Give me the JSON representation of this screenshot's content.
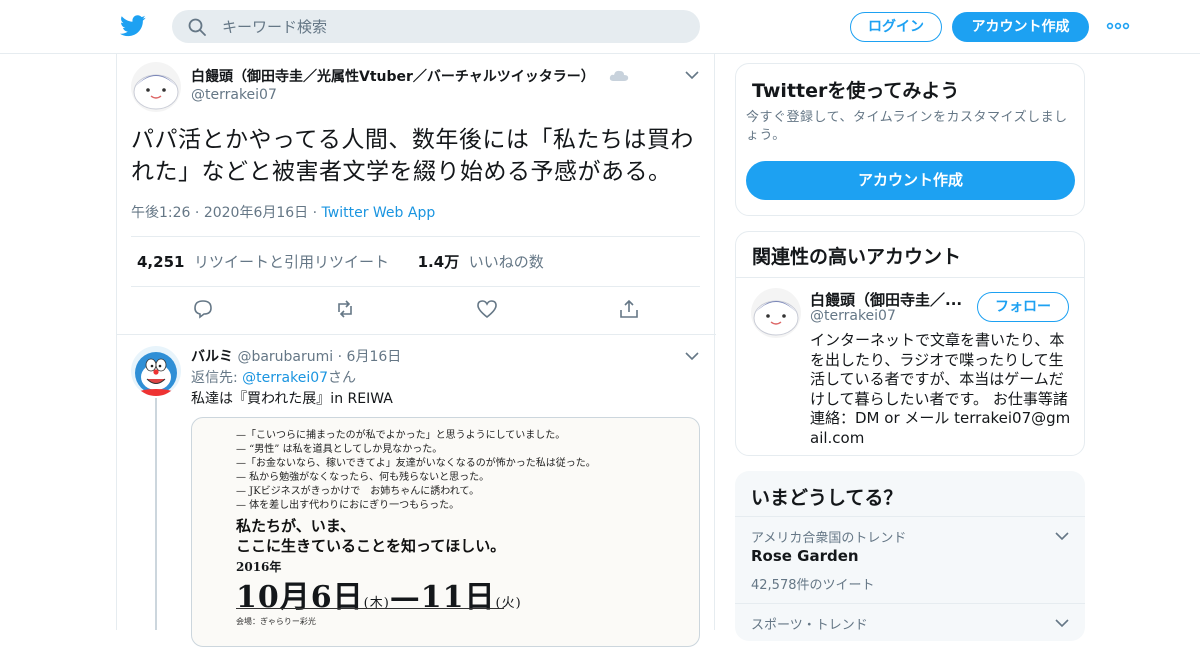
{
  "header": {
    "search_placeholder": "キーワード検索",
    "login_label": "ログイン",
    "signup_label": "アカウント作成",
    "brand_color": "#1da1f2"
  },
  "tweet": {
    "name": "白饅頭（御田寺圭／光属性Vtuber／バーチャルツイッタラー）",
    "handle": "@terrakei07",
    "text": "パパ活とかやってる人間、数年後には「私たちは買われた」などと被害者文学を綴り始める予感がある。",
    "time": "午後1:26",
    "date": "2020年6月16日",
    "source": "Twitter Web App",
    "retweets_count": "4,251",
    "retweets_label": "リツイートと引用リツイート",
    "likes_count": "1.4万",
    "likes_label": "いいねの数"
  },
  "reply": {
    "name": "バルミ",
    "handle": "@barubarumi",
    "date": "6月16日",
    "reply_to_label": "返信先:",
    "reply_to_handle": "@terrakei07",
    "reply_to_suffix": "さん",
    "text": "私達は『買われた展』in REIWA",
    "poster": {
      "lines": [
        "—「こいつらに捕まったのが私でよかった」と思うようにしていました。",
        "— “男性” は私を道具としてしか見なかった。",
        "—「お金ないなら、稼いできてよ」友達がいなくなるのが怖かった私は従った。",
        "— 私から勉強がなくなったら、何も残らないと思った。",
        "— JKビジネスがきっかけで　お姉ちゃんに誘われて。",
        "— 体を差し出す代わりにおにぎり一つもらった。"
      ],
      "headline1": "私たちが、いま、",
      "headline2": "ここに生きていることを知ってほしい。",
      "year": "2016年",
      "date_main": "10月6日",
      "date_start_day": "(木)",
      "date_dash": "—",
      "date_end": "11日",
      "date_end_day": "(火)",
      "venue": "会場：ぎゃらりー彩光"
    }
  },
  "signup_card": {
    "title": "Twitterを使ってみよう",
    "description": "今すぐ登録して、タイムラインをカスタマイズしましょう。",
    "button_label": "アカウント作成"
  },
  "related_card": {
    "title": "関連性の高いアカウント",
    "name": "白饅頭（御田寺圭／...",
    "handle": "@terrakei07",
    "follow_label": "フォロー",
    "bio": "インターネットで文章を書いたり、本を出したり、ラジオで喋ったりして生活している者ですが、本当はゲームだけして暮らしたい者です。 お仕事等諸連絡：DM or メール terrakei07@gmail.com"
  },
  "trends_card": {
    "title": "いまどうしてる？",
    "trends": [
      {
        "context": "アメリカ合衆国のトレンド",
        "name": "Rose Garden",
        "count": "42,578件のツイート"
      },
      {
        "context": "スポーツ・トレンド",
        "name": "",
        "count": ""
      }
    ]
  }
}
